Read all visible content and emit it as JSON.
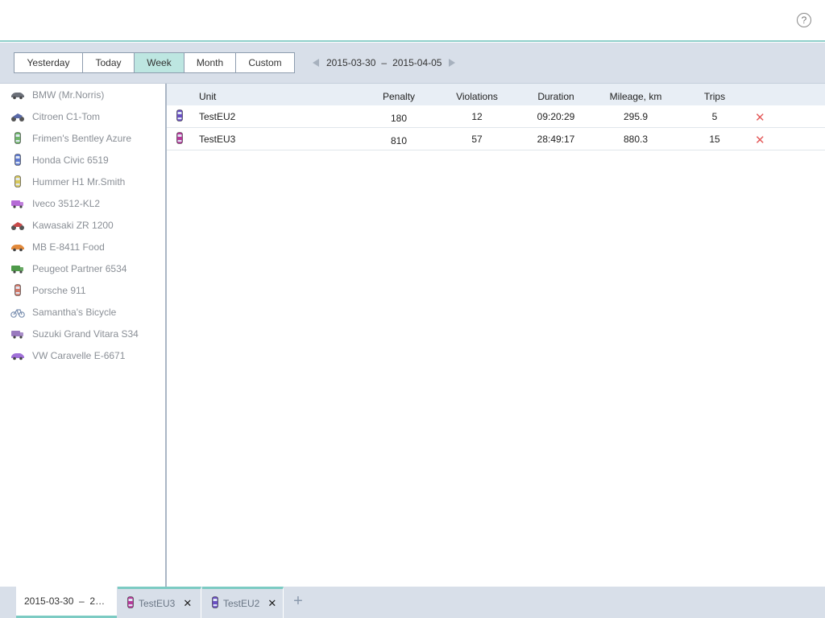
{
  "header": {
    "help_label": "?"
  },
  "toolbar": {
    "periods": [
      {
        "label": "Yesterday"
      },
      {
        "label": "Today"
      },
      {
        "label": "Week"
      },
      {
        "label": "Month"
      },
      {
        "label": "Custom"
      }
    ],
    "active_period": "Week",
    "date_from": "2015-03-30",
    "date_separator": "–",
    "date_to": "2015-04-05"
  },
  "sidebar": {
    "units": [
      {
        "label": "BMW (Mr.Norris)",
        "icon": "car-icon",
        "color": "#6b6f78"
      },
      {
        "label": "Citroen C1-Tom",
        "icon": "quad-bike-icon",
        "color": "#5a6aa8"
      },
      {
        "label": "Frimen's Bentley Azure",
        "icon": "car-topview-icon",
        "color": "#6fb56a"
      },
      {
        "label": "Honda Civic 6519",
        "icon": "car-topview-icon",
        "color": "#5f7ad0"
      },
      {
        "label": "Hummer H1 Mr.Smith",
        "icon": "car-topview-icon",
        "color": "#d8c85a"
      },
      {
        "label": "Iveco 3512-KL2",
        "icon": "truck-icon",
        "color": "#b56ad6"
      },
      {
        "label": "Kawasaki ZR 1200",
        "icon": "motorcycle-icon",
        "color": "#c84a4a"
      },
      {
        "label": "MB E-8411 Food",
        "icon": "sports-car-icon",
        "color": "#e28a3c"
      },
      {
        "label": "Peugeot Partner 6534",
        "icon": "van-icon",
        "color": "#4f9a4a"
      },
      {
        "label": "Porsche 911",
        "icon": "car-topview-icon",
        "color": "#d07a6a"
      },
      {
        "label": "Samantha's Bicycle",
        "icon": "bicycle-icon",
        "color": "#7a8fb0"
      },
      {
        "label": "Suzuki Grand Vitara S34",
        "icon": "trolleybus-icon",
        "color": "#9a7abf"
      },
      {
        "label": "VW Caravelle E-6671",
        "icon": "sports-car-icon",
        "color": "#a070d8"
      }
    ]
  },
  "table": {
    "headers": {
      "unit": "Unit",
      "penalty": "Penalty",
      "violations": "Violations",
      "duration": "Duration",
      "mileage": "Mileage, km",
      "trips": "Trips"
    },
    "rows": [
      {
        "unit": "TestEU2",
        "penalty": "180",
        "violations": "12",
        "duration": "09:20:29",
        "mileage": "295.9",
        "trips": "5",
        "icon": "car-topview-icon",
        "color": "#6a4fc2"
      },
      {
        "unit": "TestEU3",
        "penalty": "810",
        "violations": "57",
        "duration": "28:49:17",
        "mileage": "880.3",
        "trips": "15",
        "icon": "car-topview-icon",
        "color": "#b63a9a"
      }
    ],
    "delete_glyph": "✕"
  },
  "bottom_tabs": {
    "date_tab": "2015-03-30  –  2…",
    "unit_tabs": [
      {
        "label": "TestEU3",
        "close": "✕",
        "color": "#b63a9a"
      },
      {
        "label": "TestEU2",
        "close": "✕",
        "color": "#6a4fc2"
      }
    ],
    "add_glyph": "+"
  }
}
